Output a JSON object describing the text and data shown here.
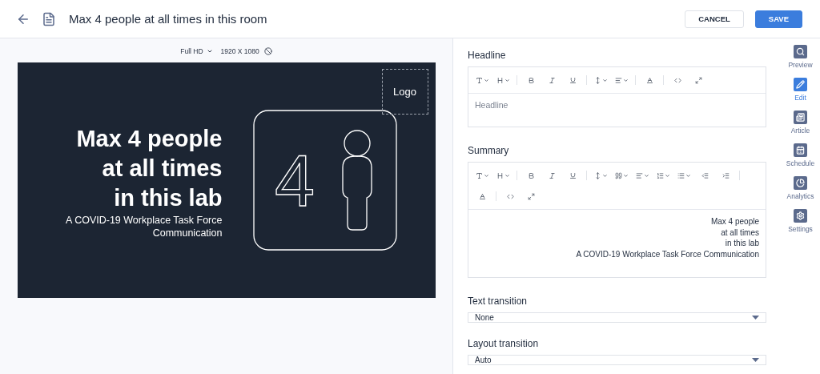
{
  "header": {
    "title": "Max 4 people at all times in this room",
    "cancel": "CANCEL",
    "save": "SAVE"
  },
  "preview": {
    "resolution": "Full HD",
    "size": "1920 X 1080",
    "slide": {
      "title_lines": [
        "Max 4 people",
        "at all times",
        "in this lab"
      ],
      "subtitle": "A COVID-19 Workplace Task Force Communication",
      "sign_digit": "4",
      "logo": "Logo"
    }
  },
  "form": {
    "headline": {
      "label": "Headline",
      "placeholder": "Headline",
      "toolbar": [
        {
          "kind": "font",
          "dropdown": true
        },
        {
          "kind": "size",
          "dropdown": true
        },
        {
          "kind": "sep"
        },
        {
          "kind": "bold"
        },
        {
          "kind": "italic"
        },
        {
          "kind": "underline"
        },
        {
          "kind": "sep"
        },
        {
          "kind": "lineheight",
          "dropdown": true
        },
        {
          "kind": "align",
          "dropdown": true
        },
        {
          "kind": "sep"
        },
        {
          "kind": "color"
        },
        {
          "kind": "sep"
        },
        {
          "kind": "code"
        },
        {
          "kind": "expand"
        }
      ]
    },
    "summary": {
      "label": "Summary",
      "lines": [
        "Max 4 people",
        "at all times",
        "in this lab",
        "A COVID-19 Workplace Task Force Communication"
      ],
      "toolbar": [
        {
          "kind": "font",
          "dropdown": true
        },
        {
          "kind": "size",
          "dropdown": true
        },
        {
          "kind": "sep"
        },
        {
          "kind": "bold"
        },
        {
          "kind": "italic"
        },
        {
          "kind": "underline"
        },
        {
          "kind": "sep"
        },
        {
          "kind": "lineheight",
          "dropdown": true
        },
        {
          "kind": "quote",
          "dropdown": true
        },
        {
          "kind": "align",
          "dropdown": true
        },
        {
          "kind": "ordered",
          "dropdown": true
        },
        {
          "kind": "bullets",
          "dropdown": true
        },
        {
          "kind": "outdent"
        },
        {
          "kind": "indent"
        },
        {
          "kind": "sep"
        },
        {
          "kind": "color"
        },
        {
          "kind": "sep"
        },
        {
          "kind": "code"
        },
        {
          "kind": "expand"
        }
      ]
    },
    "selects": [
      {
        "label": "Text transition",
        "value": "None"
      },
      {
        "label": "Layout transition",
        "value": "Auto"
      }
    ]
  },
  "sidebar": [
    {
      "kind": "preview",
      "label": "Preview",
      "selected": false
    },
    {
      "kind": "edit",
      "label": "Edit",
      "selected": true
    },
    {
      "kind": "article",
      "label": "Article",
      "selected": false
    },
    {
      "kind": "schedule",
      "label": "Schedule",
      "selected": false
    },
    {
      "kind": "analytics",
      "label": "Analytics",
      "selected": false
    },
    {
      "kind": "settings",
      "label": "Settings",
      "selected": false
    }
  ]
}
